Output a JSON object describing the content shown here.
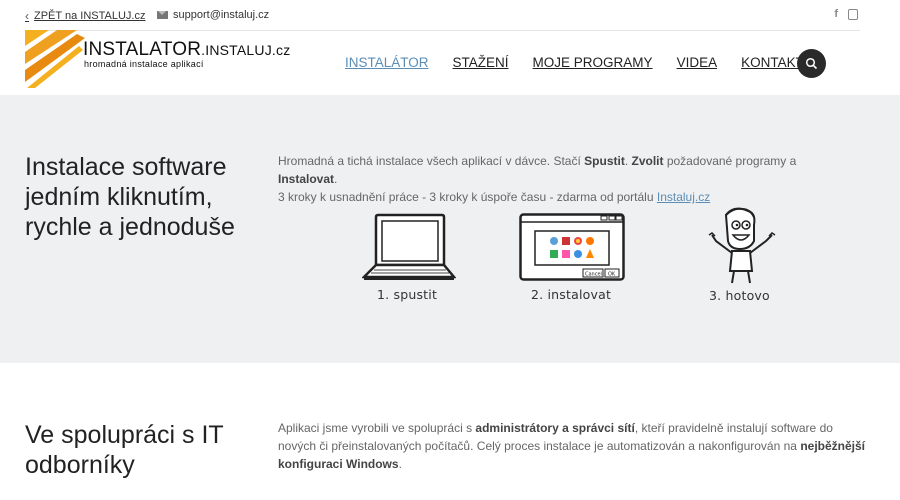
{
  "topbar": {
    "back_label": "ZPĚT na INSTALUJ.cz",
    "support_email": "support@instaluj.cz",
    "facebook_glyph": "f"
  },
  "brand": {
    "title_main": "INSTALATOR",
    "title_domain": ".INSTALUJ.cz",
    "subtitle": "hromadná instalace aplikací",
    "logo_colors": [
      "#f0a020",
      "#f5b020",
      "#e88a10"
    ]
  },
  "nav": {
    "items": [
      {
        "label": "INSTALÁTOR",
        "active": true
      },
      {
        "label": "STAŽENÍ",
        "active": false
      },
      {
        "label": "MOJE PROGRAMY",
        "active": false
      },
      {
        "label": "VIDEA",
        "active": false
      },
      {
        "label": "KONTAKT",
        "active": false
      }
    ],
    "active_color": "#5b8db5"
  },
  "hero": {
    "heading": "Instalace software jedním kliknutím, rychle a jednoduše",
    "line1_a": "Hromadná a tichá instalace všech aplikací v dávce. Stačí ",
    "line1_b1": "Spustit",
    "line1_sep": ". ",
    "line1_b2": "Zvolit",
    "line1_c": " požadované programy a ",
    "line1_b3": "Instalovat",
    "line1_end": ".",
    "line2": "3 kroky k usnadnění práce - 3 kroky k úspoře času - zdarma od portálu ",
    "line2_link": "Instaluj.cz",
    "steps": [
      {
        "label": "1. spustit",
        "icon": "laptop-icon"
      },
      {
        "label": "2. instalovat",
        "icon": "installer-window-icon"
      },
      {
        "label": "3. hotovo",
        "icon": "happy-character-icon"
      }
    ],
    "window_cancel": "Cancel",
    "window_ok": "OK"
  },
  "section2": {
    "heading": "Ve spolupráci s IT odborníky",
    "t1": "Aplikaci jsme vyrobili ve spolupráci s ",
    "b1": "administrátory a správci sítí",
    "t2": ", kteří pravidelně instalují software do nových či přeinstalovaných počítačů. Celý proces instalace je automatizován a nakonfigurován na ",
    "b2": "nejběžnější konfiguraci Windows",
    "t3": "."
  }
}
